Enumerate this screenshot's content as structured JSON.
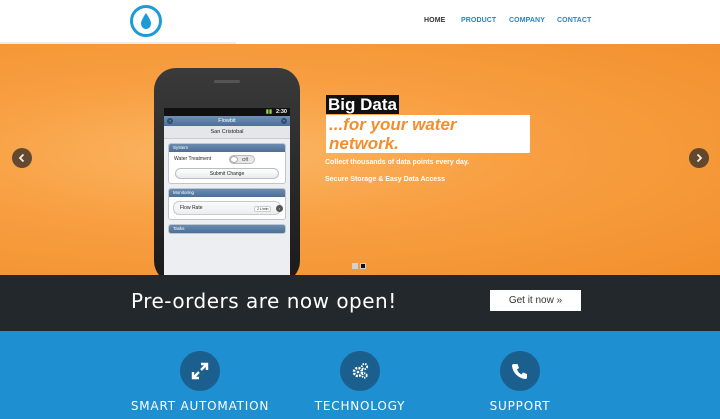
{
  "header": {
    "logo_icon": "water-drop-icon",
    "nav": [
      {
        "label": "HOME"
      },
      {
        "label": "PRODUCT"
      },
      {
        "label": "COMPANY"
      },
      {
        "label": "CONTACT"
      }
    ]
  },
  "hero": {
    "headline_line1": "Big Data",
    "headline_line2": "...for your water network.",
    "blurb_line1": "Collect thousands of data points every day.",
    "blurb_line2": "Secure Storage & Easy Data Access",
    "prev_icon": "chevron-left-icon",
    "next_icon": "chevron-right-icon",
    "slide_count": 2,
    "active_slide": 2
  },
  "phone": {
    "status_time": "2:30",
    "app_title": "Flowbit",
    "location": "San Cristobal",
    "system_header": "System",
    "water_treatment_label": "Water Treatment",
    "toggle_value": "Off",
    "submit_label": "Submit Change",
    "monitoring_header": "Monitoring",
    "flow_rate_label": "Flow Rate",
    "flow_rate_value": "2 L/min",
    "tasks_header": "Tasks"
  },
  "preorder": {
    "text": "Pre-orders are now open!",
    "button_label": "Get it now »"
  },
  "features": [
    {
      "label": "SMART AUTOMATION",
      "icon": "expand-arrows-icon"
    },
    {
      "label": "TECHNOLOGY",
      "icon": "gears-icon"
    },
    {
      "label": "SUPPORT",
      "icon": "phone-icon"
    }
  ],
  "colors": {
    "brand_blue": "#1e9bd7",
    "hero_orange": "#f28f2c",
    "dark_band": "#22282c",
    "features_blue": "#1e8fd0"
  }
}
